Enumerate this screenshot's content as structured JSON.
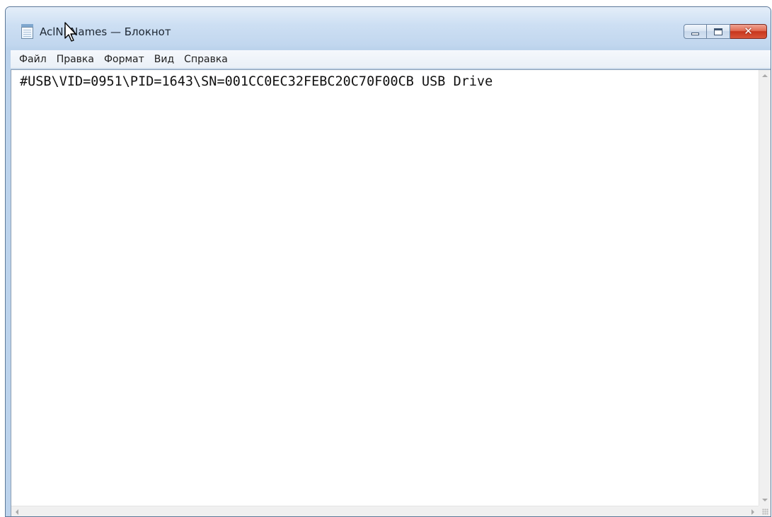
{
  "window": {
    "title": "AclNbNames — Блокнот",
    "icon": "notepad-icon",
    "controls": {
      "minimize": "minimize-icon",
      "maximize": "maximize-icon",
      "close": "close-icon"
    }
  },
  "menu": {
    "items": [
      "Файл",
      "Правка",
      "Формат",
      "Вид",
      "Справка"
    ]
  },
  "editor": {
    "text": "#USB\\VID=0951\\PID=1643\\SN=001CC0EC32FEBC20C70F00CB USB Drive"
  },
  "colors": {
    "close_button": "#c7351c",
    "frame": "#bcd3ec",
    "editor_bg": "#ffffff"
  }
}
